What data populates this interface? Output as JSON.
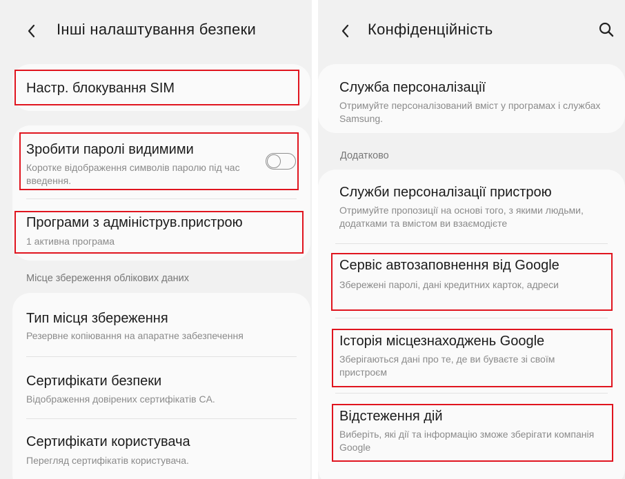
{
  "left": {
    "title": "Інші налаштування безпеки",
    "items": [
      {
        "title": "Настр. блокування SIM"
      },
      {
        "title": "Зробити паролі видимими",
        "subtitle": "Коротке відображення символів паролю під час введення.",
        "toggle": "off"
      },
      {
        "title": "Програми з адмініструв.пристрою",
        "subtitle": "1 активна програма"
      },
      {
        "title": "Тип місця збереження",
        "subtitle": "Резервне копіювання на апаратне забезпечення"
      },
      {
        "title": "Сертифікати безпеки",
        "subtitle": "Відображення довірених сертифікатів CA."
      },
      {
        "title": "Сертифікати користувача",
        "subtitle": "Перегляд сертифікатів користувача."
      }
    ],
    "section": "Місце збереження облікових даних"
  },
  "right": {
    "title": "Конфіденційність",
    "items": [
      {
        "title": "Служба персоналізації",
        "subtitle": "Отримуйте персоналізований вміст у програмах і службах Samsung."
      },
      {
        "title": "Служби персоналізації пристрою",
        "subtitle": "Отримуйте пропозиції на основі того, з якими людьми, додатками та вмістом ви взаємодієте"
      },
      {
        "title": "Сервіс автозаповнення від Google",
        "subtitle": "Збережені паролі, дані кредитних карток, адреси"
      },
      {
        "title": "Історія місцезнаходжень Google",
        "subtitle": "Зберігаються дані про те, де ви буваєте зі своїм пристроєм"
      },
      {
        "title": "Відстеження дій",
        "subtitle": "Виберіть, які дії та інформацію зможе зберігати компанія Google"
      }
    ],
    "section": "Додатково"
  },
  "colors": {
    "highlight": "#e0141e",
    "background": "#f1f1f1",
    "card": "#fafafa"
  },
  "icons": {
    "back": "chevron-left-icon",
    "search": "search-icon"
  }
}
